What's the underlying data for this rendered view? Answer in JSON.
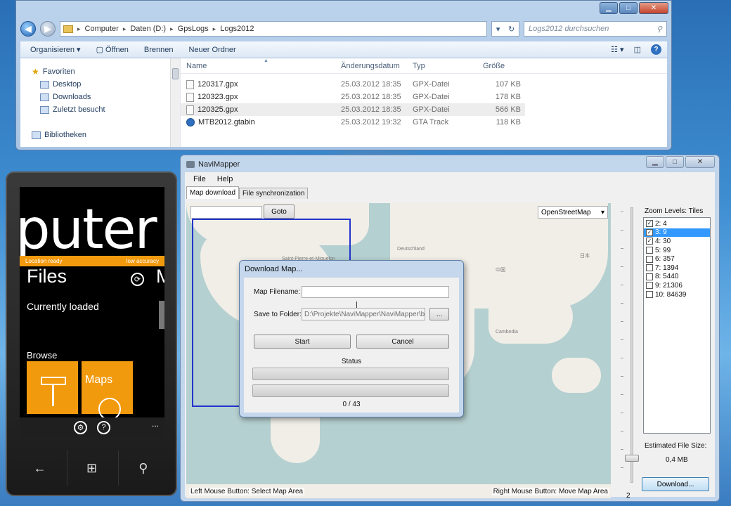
{
  "explorer": {
    "breadcrumb": [
      "Computer",
      "Daten (D:)",
      "GpsLogs",
      "Logs2012"
    ],
    "search_placeholder": "Logs2012 durchsuchen",
    "toolbar": [
      "Organisieren",
      "Öffnen",
      "Brennen",
      "Neuer Ordner"
    ],
    "nav": {
      "favorites": "Favoriten",
      "items": [
        "Desktop",
        "Downloads",
        "Zuletzt besucht"
      ],
      "libraries": "Bibliotheken"
    },
    "columns": [
      "Name",
      "Änderungsdatum",
      "Typ",
      "Größe"
    ],
    "files": [
      {
        "name": "120317.gpx",
        "date": "25.03.2012 18:35",
        "type": "GPX-Datei",
        "size": "107 KB"
      },
      {
        "name": "120323.gpx",
        "date": "25.03.2012 18:35",
        "type": "GPX-Datei",
        "size": "178 KB"
      },
      {
        "name": "120325.gpx",
        "date": "25.03.2012 18:35",
        "type": "GPX-Datei",
        "size": "566 KB"
      },
      {
        "name": "MTB2012.gtabin",
        "date": "25.03.2012 19:32",
        "type": "GTA Track",
        "size": "118 KB"
      }
    ]
  },
  "phone": {
    "panorama_title": "puter",
    "location_status": "Location ready",
    "accuracy": "low accuracy",
    "section_title": "Files",
    "next_section_peek": "M",
    "currently_loaded": "Currently loaded",
    "browse": "Browse",
    "tile_maps": "Maps",
    "dots": "..."
  },
  "navi": {
    "title": "NaviMapper",
    "menu": [
      "File",
      "Help"
    ],
    "tabs": [
      "Map download",
      "File synchronization"
    ],
    "goto_label": "Goto",
    "provider": "OpenStreetMap",
    "hint_left": "Left Mouse Button: Select Map Area",
    "hint_right": "Right Mouse Button: Move Map Area",
    "zoom_levels_label": "Zoom Levels: Tiles",
    "zoom_levels": [
      {
        "label": "2: 4",
        "checked": true,
        "selected": false
      },
      {
        "label": "3: 9",
        "checked": true,
        "selected": true
      },
      {
        "label": "4: 30",
        "checked": true,
        "selected": false
      },
      {
        "label": "5: 99",
        "checked": false,
        "selected": false
      },
      {
        "label": "6: 357",
        "checked": false,
        "selected": false
      },
      {
        "label": "7: 1394",
        "checked": false,
        "selected": false
      },
      {
        "label": "8: 5440",
        "checked": false,
        "selected": false
      },
      {
        "label": "9: 21306",
        "checked": false,
        "selected": false
      },
      {
        "label": "10: 84639",
        "checked": false,
        "selected": false
      }
    ],
    "slider_value": "2",
    "estimated_label": "Estimated File Size:",
    "estimated_value": "0,4 MB",
    "download_label": "Download..."
  },
  "dialog": {
    "title": "Download Map...",
    "filename_label": "Map Filename:",
    "filename_value": "",
    "folder_label": "Save to Folder:",
    "folder_value": "D:\\Projekte\\NaviMapper\\NaviMapper\\bin\\",
    "browse_label": "...",
    "start_label": "Start",
    "cancel_label": "Cancel",
    "status_label": "Status",
    "progress_text": "0 / 43",
    "progress_fraction_1": 0,
    "progress_fraction_2": 0
  }
}
